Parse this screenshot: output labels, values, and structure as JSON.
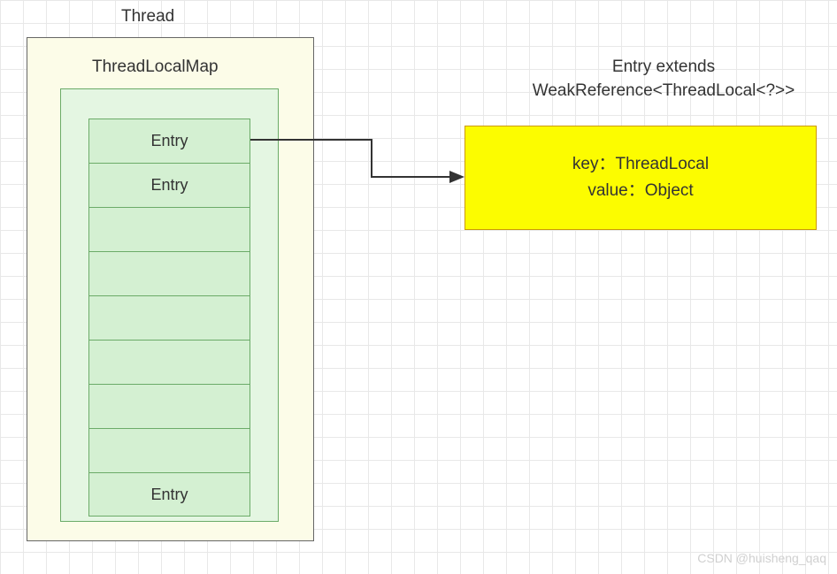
{
  "thread": {
    "label": "Thread"
  },
  "map": {
    "label": "ThreadLocalMap",
    "entries": [
      {
        "label": "Entry"
      },
      {
        "label": "Entry"
      },
      {
        "label": ""
      },
      {
        "label": ""
      },
      {
        "label": ""
      },
      {
        "label": ""
      },
      {
        "label": ""
      },
      {
        "label": ""
      },
      {
        "label": "Entry"
      }
    ]
  },
  "entryDetail": {
    "title_line1": "Entry extends",
    "title_line2": "WeakReference<ThreadLocal<?>>",
    "key_line": "key：ThreadLocal",
    "value_line": "value：Object"
  },
  "watermark": "CSDN @huisheng_qaq"
}
